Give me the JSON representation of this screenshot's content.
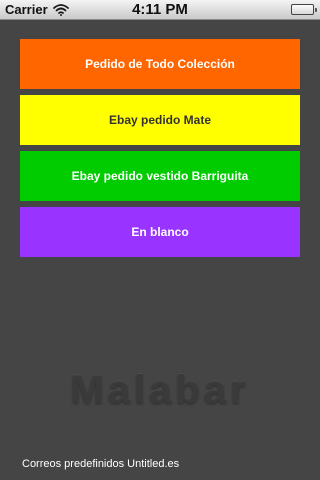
{
  "status_bar": {
    "carrier": "Carrier",
    "time": "4:11 PM",
    "wifi_icon": "wifi-icon",
    "battery_icon": "battery-icon"
  },
  "buttons": [
    {
      "label": "Pedido de Todo Colección",
      "bg": "#ff6600",
      "fg": "#ffffff"
    },
    {
      "label": "Ebay pedido Mate",
      "bg": "#ffff00",
      "fg": "#333333"
    },
    {
      "label": "Ebay pedido vestido Barriguita",
      "bg": "#00cc00",
      "fg": "#ffffff"
    },
    {
      "label": "En blanco",
      "bg": "#9933ff",
      "fg": "#ffffff"
    }
  ],
  "brand": "Malabar",
  "footer": "Correos predefinidos Untitled.es",
  "colors": {
    "background": "#454545"
  }
}
